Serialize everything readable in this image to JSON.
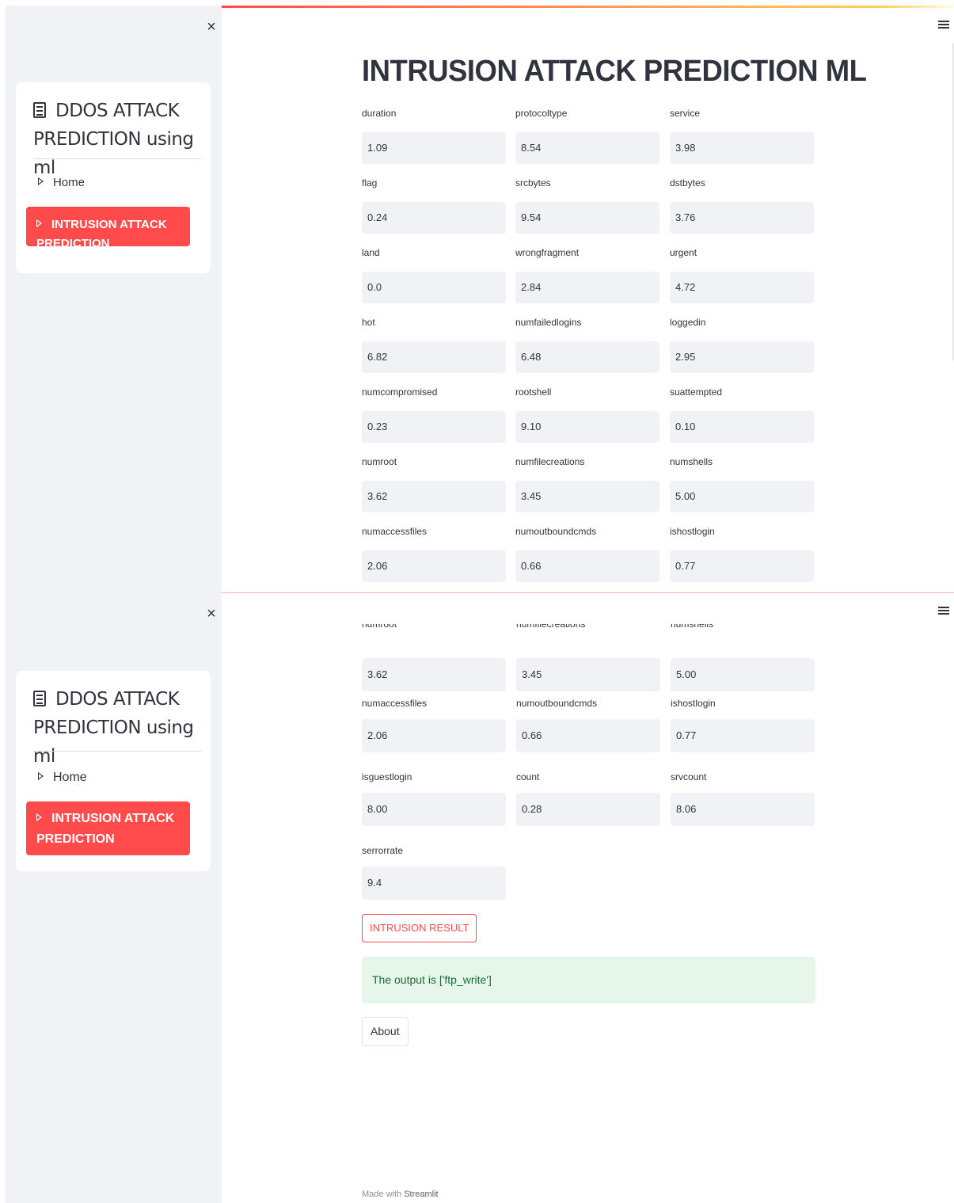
{
  "sidebar": {
    "menu_title": "DDOS ATTACK PREDICTION using ml",
    "items": [
      {
        "label": "Home"
      },
      {
        "label": "INTRUSION ATTACK PREDICTION"
      }
    ]
  },
  "main": {
    "title": "INTRUSION ATTACK PREDICTION ML",
    "fields": [
      {
        "label": "duration",
        "value": "1.09"
      },
      {
        "label": "protocoltype",
        "value": "8.54"
      },
      {
        "label": "service",
        "value": "3.98"
      },
      {
        "label": "flag",
        "value": "0.24"
      },
      {
        "label": "srcbytes",
        "value": "9.54"
      },
      {
        "label": "dstbytes",
        "value": "3.76"
      },
      {
        "label": "land",
        "value": "0.0"
      },
      {
        "label": "wrongfragment",
        "value": "2.84"
      },
      {
        "label": "urgent",
        "value": "4.72"
      },
      {
        "label": "hot",
        "value": "6.82"
      },
      {
        "label": "numfailedlogins",
        "value": "6.48"
      },
      {
        "label": "loggedin",
        "value": "2.95"
      },
      {
        "label": "numcompromised",
        "value": "0.23"
      },
      {
        "label": "rootshell",
        "value": "9.10"
      },
      {
        "label": "suattempted",
        "value": "0.10"
      },
      {
        "label": "numroot",
        "value": "3.62"
      },
      {
        "label": "numfilecreations",
        "value": "3.45"
      },
      {
        "label": "numshells",
        "value": "5.00"
      },
      {
        "label": "numaccessfiles",
        "value": "2.06"
      },
      {
        "label": "numoutboundcmds",
        "value": "0.66"
      },
      {
        "label": "ishostlogin",
        "value": "0.77"
      },
      {
        "label": "isguestlogin",
        "value": "8.00"
      },
      {
        "label": "count",
        "value": "0.28"
      },
      {
        "label": "srvcount",
        "value": "8.06"
      },
      {
        "label": "serrorrate",
        "value": "9.4"
      }
    ],
    "result_button": "INTRUSION RESULT",
    "output_text": "The output is ['ftp_write']",
    "about_button": "About",
    "footer_prefix": "Made with",
    "footer_brand": "Streamlit"
  },
  "colors": {
    "accent": "#ff4b4b",
    "sidebar_bg": "#f0f2f6",
    "success_bg": "#e7f6ea",
    "success_text": "#1a6b3a"
  }
}
